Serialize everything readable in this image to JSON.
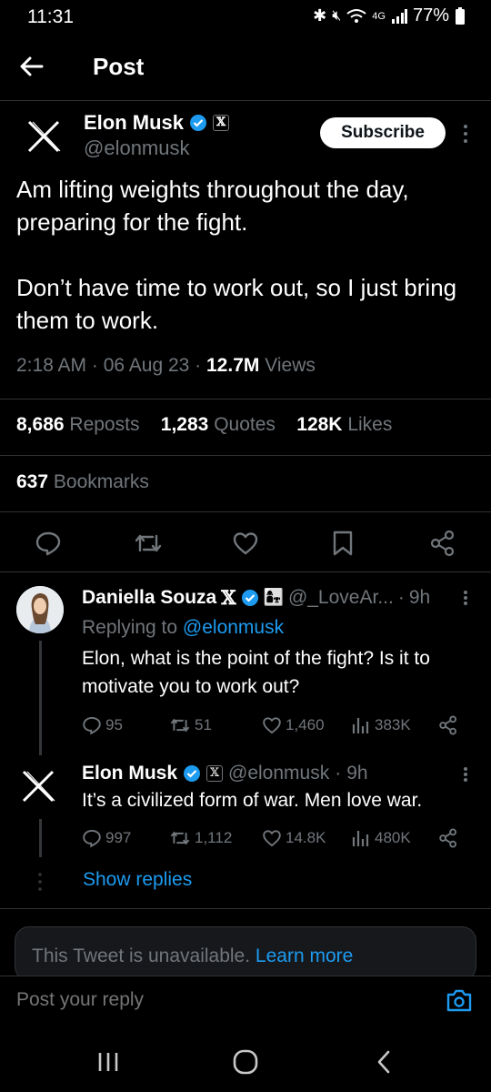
{
  "status_bar": {
    "time": "11:31",
    "network": "4G",
    "battery": "77%"
  },
  "header": {
    "title": "Post"
  },
  "post": {
    "author_name": "Elon Musk",
    "author_handle": "@elonmusk",
    "subscribe_label": "Subscribe",
    "text": "Am lifting weights throughout the day, preparing for the fight.\n\nDon’t have time to work out, so I just bring them to work.",
    "time": "2:18 AM",
    "date": "06 Aug 23",
    "views_count": "12.7M",
    "views_label": "Views",
    "reposts_count": "8,686",
    "reposts_label": "Reposts",
    "quotes_count": "1,283",
    "quotes_label": "Quotes",
    "likes_count": "128K",
    "likes_label": "Likes",
    "bookmarks_count": "637",
    "bookmarks_label": "Bookmarks"
  },
  "replies": [
    {
      "name": "Daniella Souza",
      "handle": "@_LoveAr...",
      "time": "9h",
      "replying_to_prefix": "Replying to",
      "replying_to_handle": "@elonmusk",
      "text": "Elon, what is the point of the fight? Is it to motivate you to work out?",
      "replies": "95",
      "reposts": "51",
      "likes": "1,460",
      "views": "383K"
    },
    {
      "name": "Elon Musk",
      "handle": "@elonmusk",
      "time": "9h",
      "text": "It’s a civilized form of war. Men love war.",
      "replies": "997",
      "reposts": "1,112",
      "likes": "14.8K",
      "views": "480K"
    }
  ],
  "show_replies_label": "Show replies",
  "unavailable": {
    "text": "This Tweet is unavailable.",
    "link": "Learn more"
  },
  "composer": {
    "placeholder": "Post your reply"
  },
  "colors": {
    "accent": "#1d9bf0",
    "background": "#000000",
    "muted": "#71767b",
    "text": "#e7e9ea"
  }
}
